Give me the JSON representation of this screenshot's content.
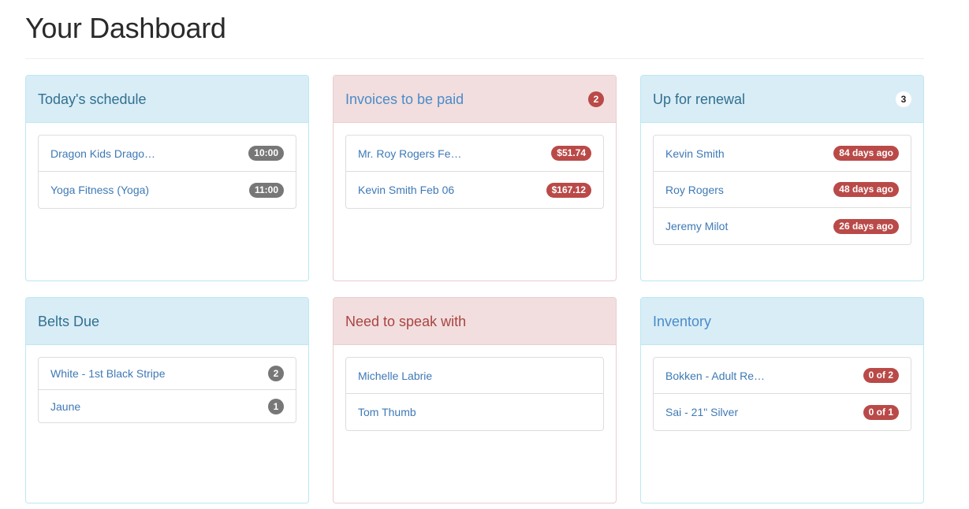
{
  "page": {
    "title": "Your Dashboard"
  },
  "schedule": {
    "title": "Today's schedule",
    "items": [
      {
        "label": "Dragon Kids Drago…",
        "time": "10:00"
      },
      {
        "label": "Yoga Fitness (Yoga)",
        "time": "11:00"
      }
    ]
  },
  "invoices": {
    "title": "Invoices to be paid",
    "count": "2",
    "items": [
      {
        "label": "Mr. Roy Rogers Fe…",
        "amount": "$51.74"
      },
      {
        "label": "Kevin Smith Feb 06",
        "amount": "$167.12"
      }
    ]
  },
  "renewal": {
    "title": "Up for renewal",
    "count": "3",
    "items": [
      {
        "label": "Kevin Smith",
        "age": "84 days ago"
      },
      {
        "label": "Roy Rogers",
        "age": "48 days ago"
      },
      {
        "label": "Jeremy Milot",
        "age": "26 days ago"
      }
    ]
  },
  "belts": {
    "title": "Belts Due",
    "items": [
      {
        "label": "White - 1st Black Stripe",
        "count": "2"
      },
      {
        "label": "Jaune",
        "count": "1"
      }
    ]
  },
  "speak": {
    "title": "Need to speak with",
    "items": [
      {
        "label": "Michelle Labrie"
      },
      {
        "label": "Tom Thumb"
      }
    ]
  },
  "inventory": {
    "title": "Inventory",
    "items": [
      {
        "label": "Bokken - Adult Re…",
        "stock": "0 of 2"
      },
      {
        "label": "Sai - 21\" Silver",
        "stock": "0 of 1"
      }
    ]
  },
  "colors": {
    "info_heading_bg": "#d9edf7",
    "danger_heading_bg": "#f2dede",
    "badge_red": "#b94a48",
    "badge_gray": "#777777",
    "link": "#3e79b5"
  }
}
